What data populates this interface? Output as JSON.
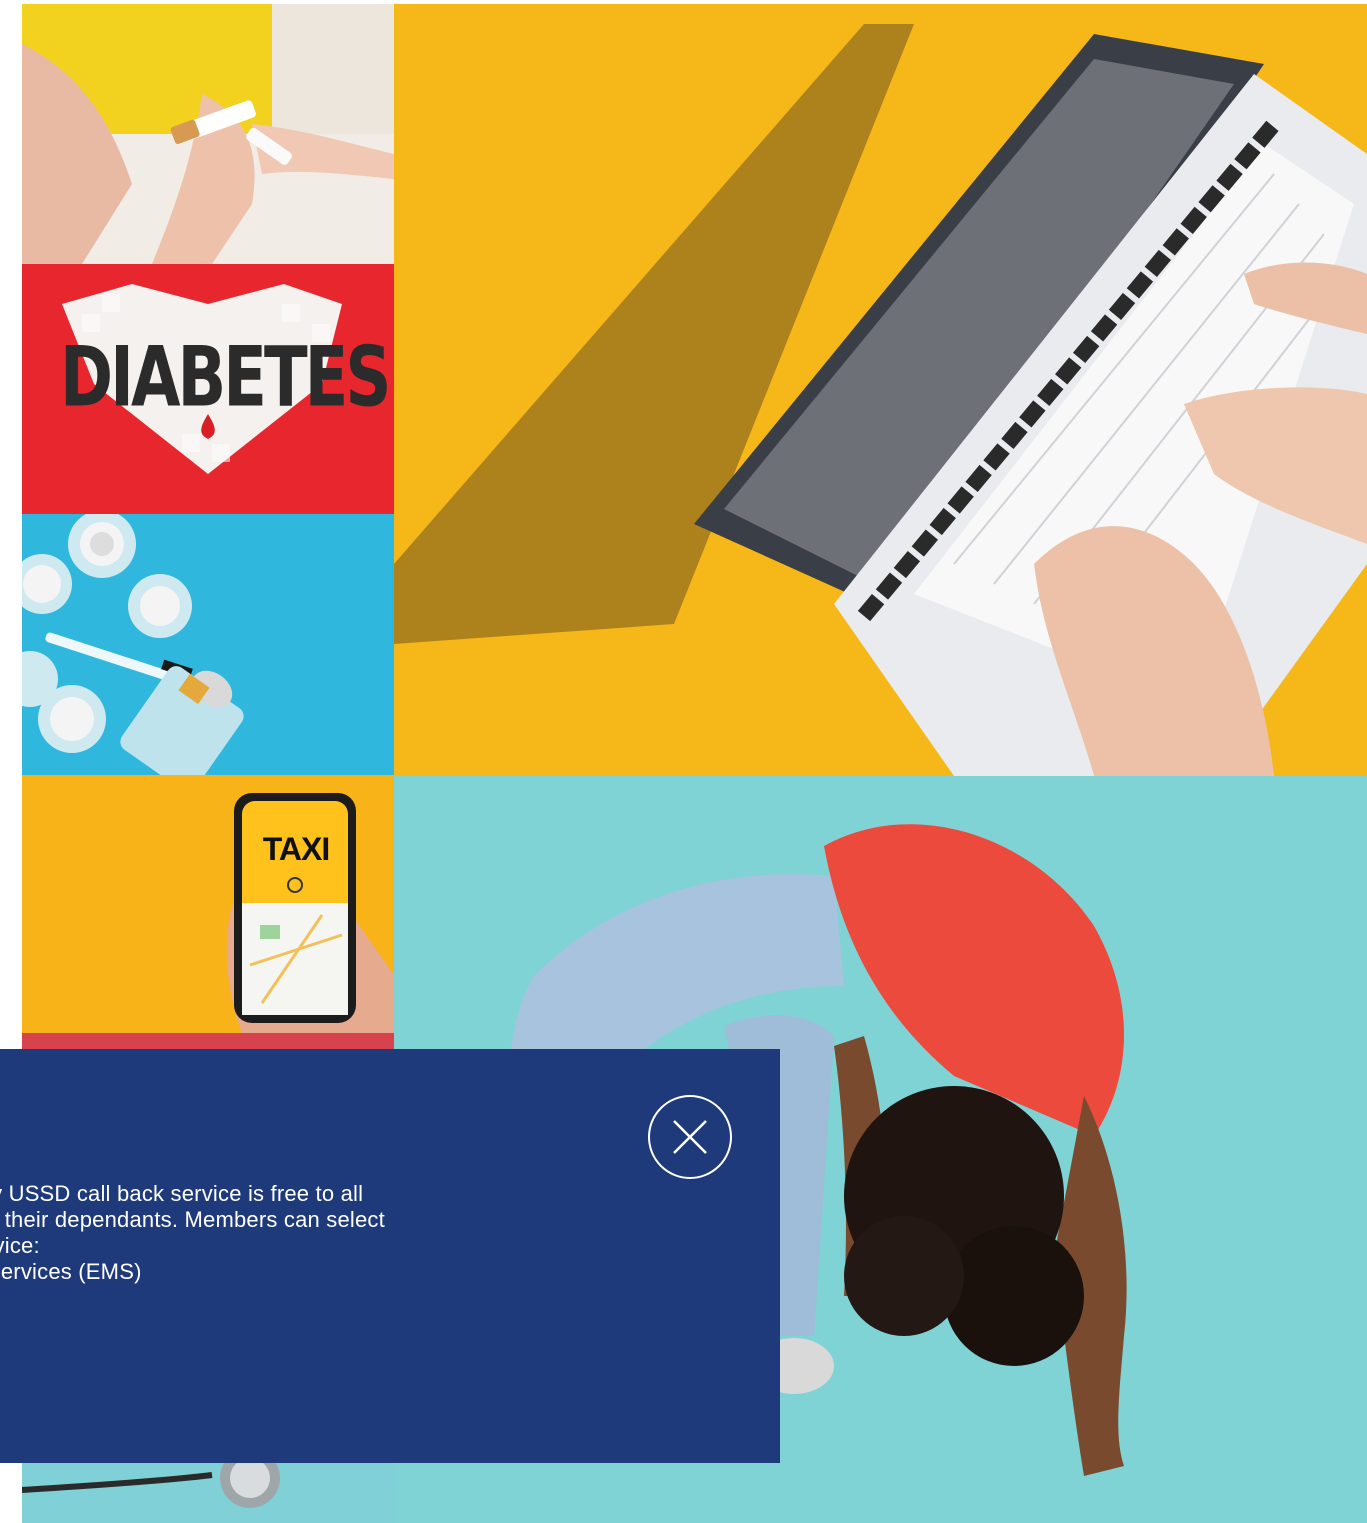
{
  "colors": {
    "modal_background": "#1e3a7b",
    "modal_text": "#ffffff",
    "yellow": "#f6b719",
    "red": "#e8262d",
    "blue": "#2fb7dd",
    "teal": "#7fd3d5"
  },
  "tiles": {
    "diabetes_text": "DIABETES",
    "taxi_text": "TAXI"
  },
  "modal": {
    "close_icon": "close-icon",
    "lines": [
      "ly USSD call back service is free to all",
      "d their dependants. Members can select",
      "rvice:",
      "Services (EMS)"
    ]
  }
}
